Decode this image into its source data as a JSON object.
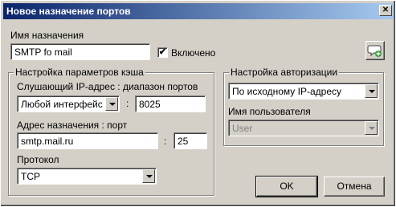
{
  "window": {
    "title": "Новое назначение портов",
    "close_glyph": "✕"
  },
  "name_section": {
    "label": "Имя назначения",
    "value": "SMTP fo mail",
    "enabled_label": "Включено",
    "enabled_checked": true,
    "check_glyph": "✔"
  },
  "cache_group": {
    "legend": "Настройка параметров кэша",
    "listen_label": "Слушающий IP-адрес : диапазон портов",
    "interface_value": "Любой интерфейс",
    "colon": ":",
    "port_range_value": "8025",
    "dest_label": "Адрес назначения : порт",
    "dest_host_value": "smtp.mail.ru",
    "dest_port_value": "25",
    "protocol_label": "Протокол",
    "protocol_value": "TCP"
  },
  "auth_group": {
    "legend": "Настройка авторизации",
    "mode_value": "По исходному IP-адресу",
    "user_label": "Имя пользователя",
    "user_value": "User"
  },
  "buttons": {
    "ok": "OK",
    "cancel": "Отмена"
  },
  "icons": {
    "comment": "comment-add-icon"
  }
}
